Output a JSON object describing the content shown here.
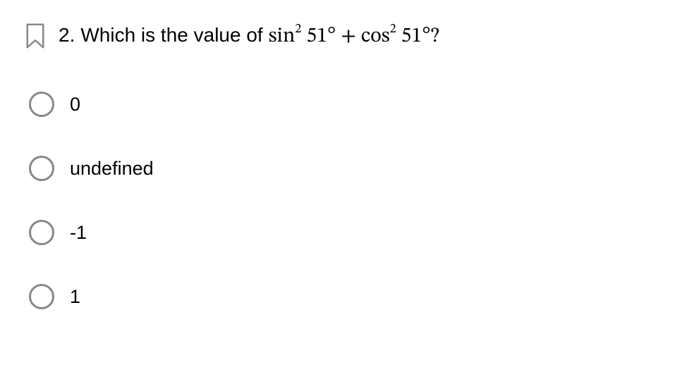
{
  "question": {
    "number": "2.",
    "stem": "Which is the value of",
    "math_sin": "sin",
    "math_sq1": "2",
    "math_angle1": " 51°",
    "math_plus": " + ",
    "math_cos": "cos",
    "math_sq2": "2",
    "math_angle2": " 51°",
    "math_q": "?"
  },
  "options": [
    {
      "label": "0"
    },
    {
      "label": "undefined"
    },
    {
      "label": "-1"
    },
    {
      "label": "1"
    }
  ]
}
